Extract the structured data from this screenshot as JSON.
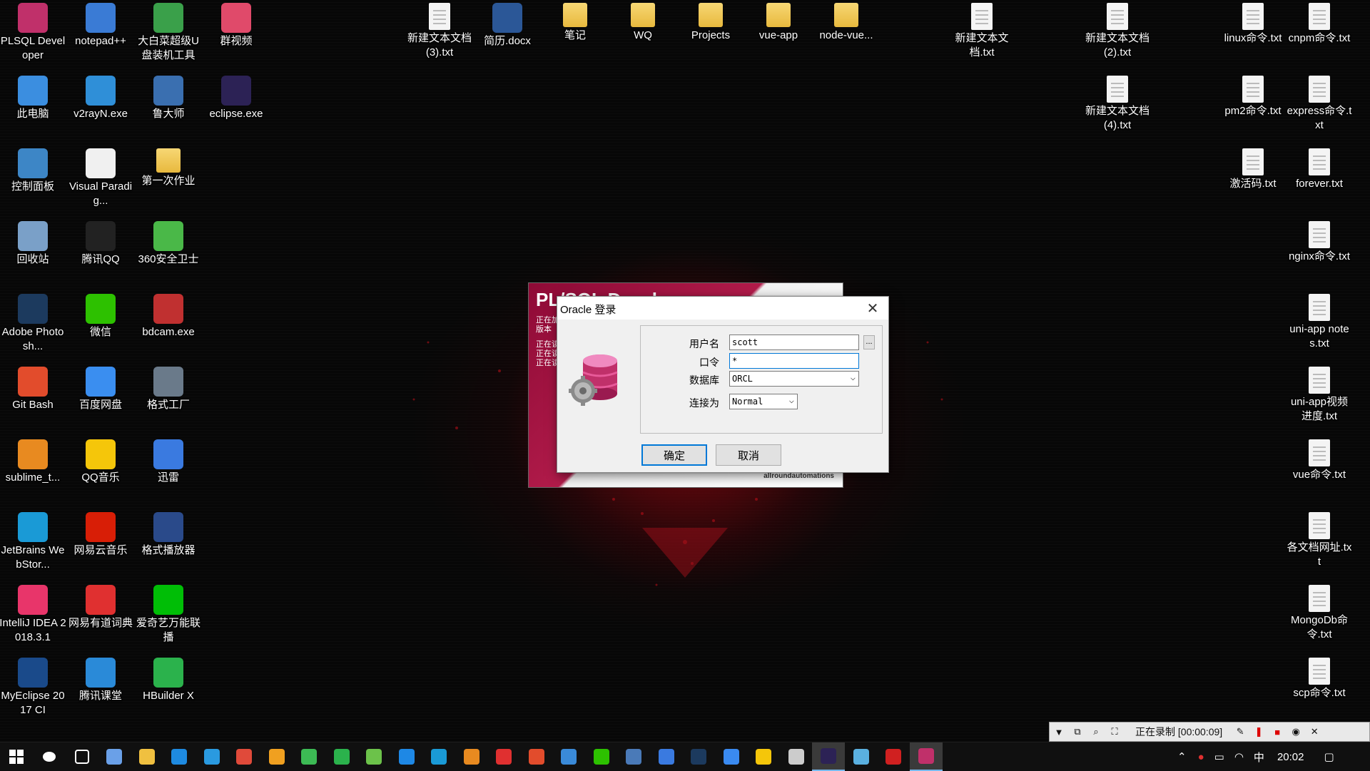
{
  "desktop": {
    "icons": [
      {
        "label": "PLSQL Developer",
        "icon": "plsql-icon",
        "color": "#c0306a"
      },
      {
        "label": "notepad++",
        "icon": "notepad-icon",
        "color": "#3a7bd5"
      },
      {
        "label": "大白菜超级U盘装机工具",
        "icon": "usb-tool-icon",
        "color": "#3aa04a"
      },
      {
        "label": "群视频",
        "icon": "video-icon",
        "color": "#e04a6a"
      },
      {
        "label": "此电脑",
        "icon": "computer-icon",
        "color": "#3b8ee0"
      },
      {
        "label": "v2rayN.exe",
        "icon": "v2ray-icon",
        "color": "#2f8fd8"
      },
      {
        "label": "鲁大师",
        "icon": "ludashi-icon",
        "color": "#3a6fb0"
      },
      {
        "label": "eclipse.exe",
        "icon": "eclipse-icon",
        "color": "#2c2255"
      },
      {
        "label": "控制面板",
        "icon": "control-panel-icon",
        "color": "#3d86c6"
      },
      {
        "label": "Visual Paradig...",
        "icon": "visual-paradigm-icon",
        "color": "#f0f0f0"
      },
      {
        "label": "第一次作业",
        "icon": "folder-icon",
        "color": "#e8c050"
      },
      {
        "label": "回收站",
        "icon": "recycle-bin-icon",
        "color": "#7aa0c8"
      },
      {
        "label": "腾讯QQ",
        "icon": "qq-icon",
        "color": "#222222"
      },
      {
        "label": "360安全卫士",
        "icon": "360-icon",
        "color": "#4ab848"
      },
      {
        "label": "Adobe Photosh...",
        "icon": "photoshop-icon",
        "color": "#1c3a5e"
      },
      {
        "label": "微信",
        "icon": "wechat-icon",
        "color": "#2dc100"
      },
      {
        "label": "bdcam.exe",
        "icon": "bandicam-icon",
        "color": "#c03030"
      },
      {
        "label": "Git Bash",
        "icon": "git-icon",
        "color": "#e24c2c"
      },
      {
        "label": "百度网盘",
        "icon": "baidu-pan-icon",
        "color": "#3a8ef0"
      },
      {
        "label": "格式工厂",
        "icon": "format-factory-icon",
        "color": "#6a7a8a"
      },
      {
        "label": "sublime_t...",
        "icon": "sublime-icon",
        "color": "#e88a20"
      },
      {
        "label": "QQ音乐",
        "icon": "qq-music-icon",
        "color": "#f5c60a"
      },
      {
        "label": "迅雷",
        "icon": "xunlei-icon",
        "color": "#3a7ae0"
      },
      {
        "label": "JetBrains WebStor...",
        "icon": "webstorm-icon",
        "color": "#1a9ad6"
      },
      {
        "label": "网易云音乐",
        "icon": "netease-music-icon",
        "color": "#d81e06"
      },
      {
        "label": "格式播放器",
        "icon": "player-icon",
        "color": "#2a4a8a"
      },
      {
        "label": "IntelliJ IDEA 2018.3.1",
        "icon": "intellij-icon",
        "color": "#e8356a"
      },
      {
        "label": "网易有道词典",
        "icon": "youdao-icon",
        "color": "#e03030"
      },
      {
        "label": "爱奇艺万能联播",
        "icon": "iqiyi-icon",
        "color": "#00be06"
      },
      {
        "label": "MyEclipse 2017 CI",
        "icon": "myeclipse-icon",
        "color": "#1a4a8a"
      },
      {
        "label": "腾讯课堂",
        "icon": "tencent-class-icon",
        "color": "#2a8ad8"
      },
      {
        "label": "HBuilder X",
        "icon": "hbuilder-icon",
        "color": "#2bb24c"
      },
      {
        "label": "新建文本文档 (3).txt",
        "icon": "text-file-icon",
        "color": "#f4f4f4"
      },
      {
        "label": "简历.docx",
        "icon": "word-file-icon",
        "color": "#2b5797"
      },
      {
        "label": "笔记",
        "icon": "folder-icon",
        "color": "#e8c050"
      },
      {
        "label": "WQ",
        "icon": "folder-icon",
        "color": "#e8c050"
      },
      {
        "label": "Projects",
        "icon": "folder-icon",
        "color": "#e8c050"
      },
      {
        "label": "vue-app",
        "icon": "folder-icon",
        "color": "#e8c050"
      },
      {
        "label": "node-vue...",
        "icon": "folder-icon",
        "color": "#e8c050"
      },
      {
        "label": "新建文本文档.txt",
        "icon": "text-file-icon",
        "color": "#f4f4f4"
      },
      {
        "label": "新建文本文档 (2).txt",
        "icon": "text-file-icon",
        "color": "#f4f4f4"
      },
      {
        "label": "新建文本文档 (4).txt",
        "icon": "text-file-icon",
        "color": "#f4f4f4"
      },
      {
        "label": "linux命令.txt",
        "icon": "text-file-icon",
        "color": "#f4f4f4"
      },
      {
        "label": "cnpm命令.txt",
        "icon": "text-file-icon",
        "color": "#f4f4f4"
      },
      {
        "label": "pm2命令.txt",
        "icon": "text-file-icon",
        "color": "#f4f4f4"
      },
      {
        "label": "express命令.txt",
        "icon": "text-file-icon",
        "color": "#f4f4f4"
      },
      {
        "label": "激活码.txt",
        "icon": "text-file-icon",
        "color": "#f4f4f4"
      },
      {
        "label": "forever.txt",
        "icon": "text-file-icon",
        "color": "#f4f4f4"
      },
      {
        "label": "nginx命令.txt",
        "icon": "text-file-icon",
        "color": "#f4f4f4"
      },
      {
        "label": "uni-app notes.txt",
        "icon": "text-file-icon",
        "color": "#f4f4f4"
      },
      {
        "label": "uni-app视频进度.txt",
        "icon": "text-file-icon",
        "color": "#f4f4f4"
      },
      {
        "label": "vue命令.txt",
        "icon": "text-file-icon",
        "color": "#f4f4f4"
      },
      {
        "label": "各文档网址.txt",
        "icon": "text-file-icon",
        "color": "#f4f4f4"
      },
      {
        "label": "MongoDb命令.txt",
        "icon": "text-file-icon",
        "color": "#f4f4f4"
      },
      {
        "label": "scp命令.txt",
        "icon": "text-file-icon",
        "color": "#f4f4f4"
      }
    ]
  },
  "splash": {
    "title": "PL/SQL Developer",
    "status_lines": [
      "正在加",
      "版本",
      "正在读",
      "正在读",
      "正在读"
    ],
    "brand": "allroundautomations"
  },
  "dialog": {
    "title": "Oracle 登录",
    "username_label": "用户名",
    "username_value": "scott",
    "password_label": "口令",
    "password_value": "*",
    "database_label": "数据库",
    "database_value": "ORCL",
    "connect_as_label": "连接为",
    "connect_as_value": "Normal",
    "browse_label": "...",
    "ok_label": "确定",
    "cancel_label": "取消"
  },
  "recorder": {
    "status": "正在录制 [00:00:09]"
  },
  "taskbar": {
    "ime": "中",
    "clock": "20:02",
    "apps": [
      {
        "icon": "cortana-icon",
        "color": "#ffffff"
      },
      {
        "icon": "task-view-icon",
        "color": "#ffffff"
      },
      {
        "icon": "pin-icon",
        "color": "#6aa0e8"
      },
      {
        "icon": "file-explorer-icon",
        "color": "#f0c040"
      },
      {
        "icon": "edge-icon",
        "color": "#1e8ae0"
      },
      {
        "icon": "ie-icon",
        "color": "#2a9ae0"
      },
      {
        "icon": "chrome-icon",
        "color": "#e04a3a"
      },
      {
        "icon": "chrome-orange-icon",
        "color": "#f0a020"
      },
      {
        "icon": "wechat-green-icon",
        "color": "#3cba54"
      },
      {
        "icon": "hbuilder-icon",
        "color": "#2bb24c"
      },
      {
        "icon": "node-icon",
        "color": "#6cc24a"
      },
      {
        "icon": "vscode-icon",
        "color": "#1e88e5"
      },
      {
        "icon": "webstorm-icon",
        "color": "#1a9ad6"
      },
      {
        "icon": "sublime-icon",
        "color": "#e88a20"
      },
      {
        "icon": "youdao-icon",
        "color": "#e03030"
      },
      {
        "icon": "git-icon",
        "color": "#e24c2c"
      },
      {
        "icon": "network-icon",
        "color": "#3a8ad8"
      },
      {
        "icon": "wechat-icon",
        "color": "#2dc100"
      },
      {
        "icon": "database-icon",
        "color": "#4a7ab8"
      },
      {
        "icon": "xunlei-icon",
        "color": "#3a7ae0"
      },
      {
        "icon": "ps-icon",
        "color": "#1c3a5e"
      },
      {
        "icon": "notes-icon",
        "color": "#3a8af0"
      },
      {
        "icon": "qq-music-icon",
        "color": "#f5c60a"
      },
      {
        "icon": "settings-icon",
        "color": "#cccccc"
      },
      {
        "icon": "eclipse-icon",
        "color": "#2c2255"
      },
      {
        "icon": "notepad-icon",
        "color": "#5ab0e0"
      },
      {
        "icon": "bandicam-icon",
        "color": "#d02020"
      },
      {
        "icon": "plsql-icon",
        "color": "#c0306a"
      }
    ]
  }
}
